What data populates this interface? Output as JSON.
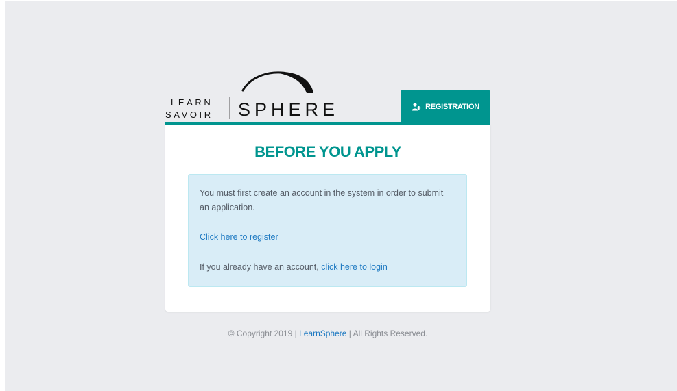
{
  "logo": {
    "word_top": "LEARN",
    "word_bottom": "SAVOIR",
    "word_main": "SPHERE"
  },
  "header": {
    "registration_tab_label": "REGISTRATION",
    "registration_icon": "user-plus-icon"
  },
  "card": {
    "title": "BEFORE YOU APPLY",
    "message": "You must first create an account in the system in order to submit an application.",
    "register_link": "Click here to register",
    "login_prefix": "If you already have an account, ",
    "login_link": "click here to login"
  },
  "footer": {
    "copyright": "© Copyright 2019 | ",
    "brand_link": "LearnSphere",
    "rights": " | All Rights Reserved."
  },
  "colors": {
    "accent": "#00958f",
    "info_bg": "#d9edf7",
    "link": "#1f7ac2",
    "page_bg": "#ebecef"
  }
}
